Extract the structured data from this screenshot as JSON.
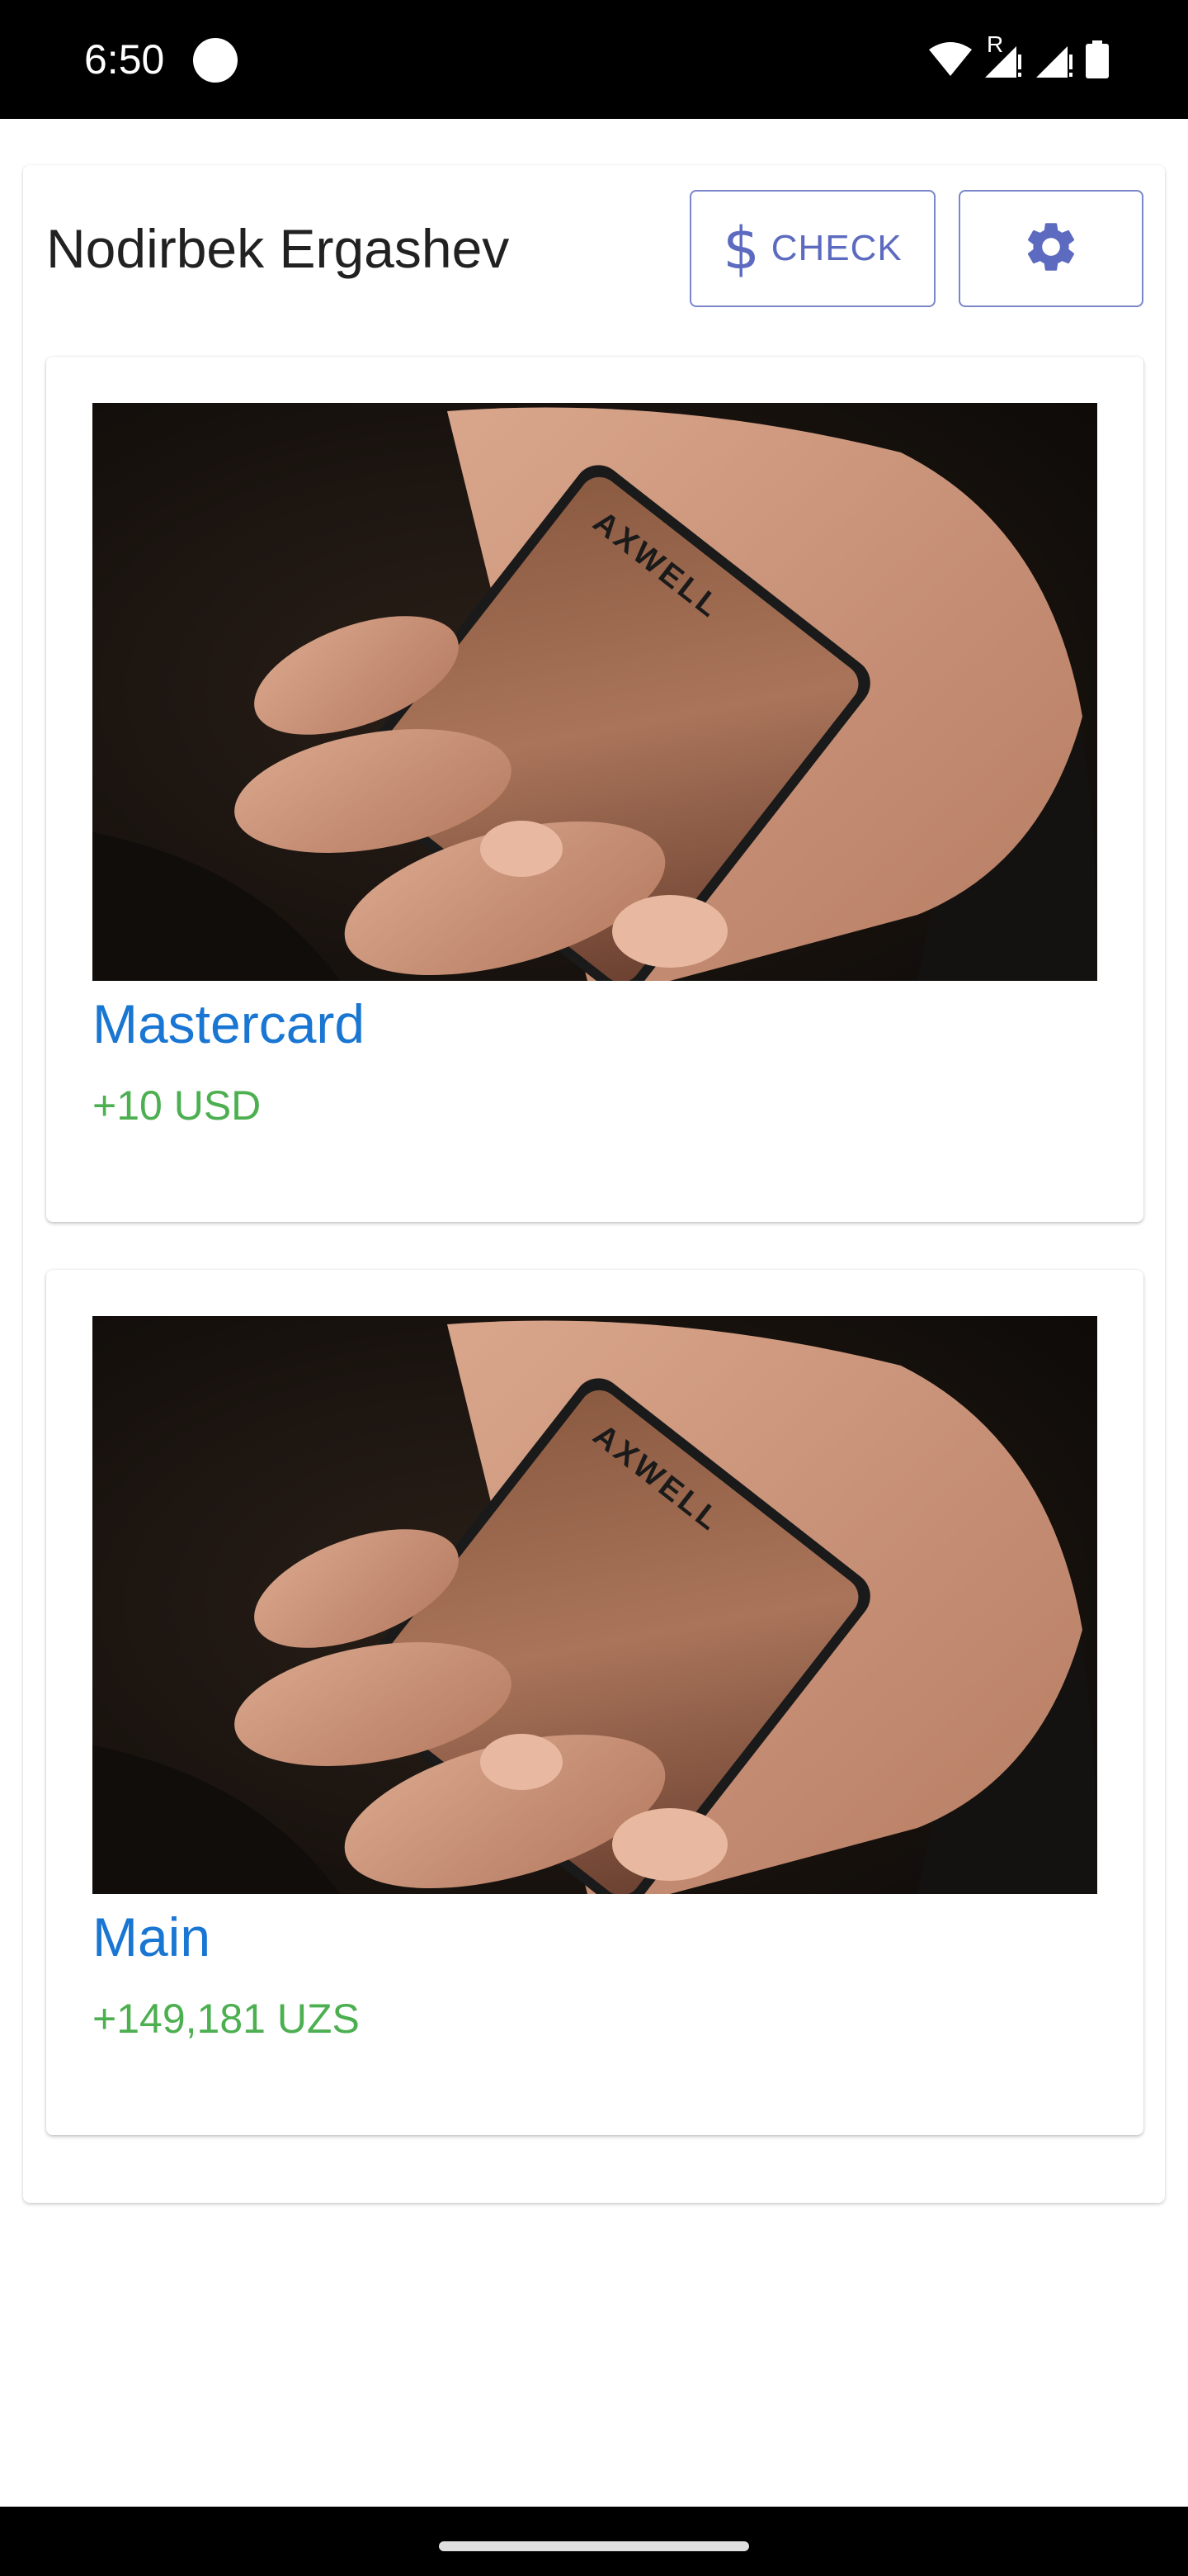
{
  "status_bar": {
    "time": "6:50",
    "icons": [
      "circle-notification-icon",
      "wifi-icon",
      "signal-roaming-icon",
      "signal-icon",
      "battery-icon"
    ],
    "roaming_label": "R"
  },
  "header": {
    "user_name": "Nodirbek Ergashev",
    "check_button": {
      "icon": "$",
      "label": "CHECK"
    },
    "settings_button": {
      "icon": "gear-icon"
    }
  },
  "accounts": [
    {
      "name": "Mastercard",
      "balance": "+10 USD",
      "image_brand": "AXWELL"
    },
    {
      "name": "Main",
      "balance": "+149,181 UZS",
      "image_brand": "AXWELL"
    }
  ],
  "colors": {
    "accent": "#5c6bc0",
    "account_name": "#1976d2",
    "balance_positive": "#4caf50",
    "text_primary": "#212121"
  }
}
